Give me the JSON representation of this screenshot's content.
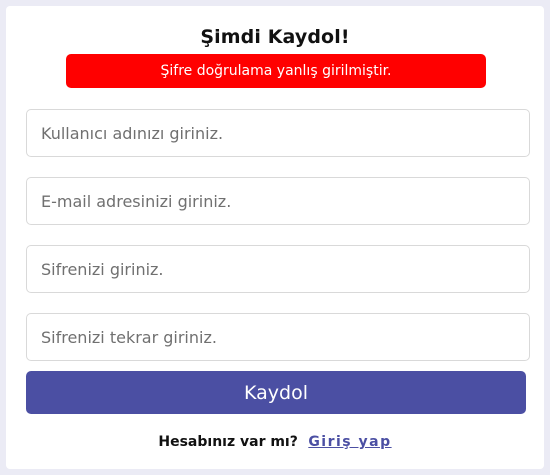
{
  "form": {
    "title": "Şimdi Kaydol!",
    "error_message": "Şifre doğrulama yanlış girilmiştir.",
    "username_placeholder": "Kullanıcı adınızı giriniz.",
    "email_placeholder": "E-mail adresinizi giriniz.",
    "password_placeholder": "Sifrenizi giriniz.",
    "password_confirm_placeholder": "Sifrenizi tekrar giriniz.",
    "submit_label": "Kaydol"
  },
  "footer": {
    "question": "Hesabınız var mı?",
    "login_link": "Giriş yap"
  },
  "colors": {
    "accent": "#4b4fa3",
    "error": "#ff0000",
    "background": "#ebebf5"
  }
}
